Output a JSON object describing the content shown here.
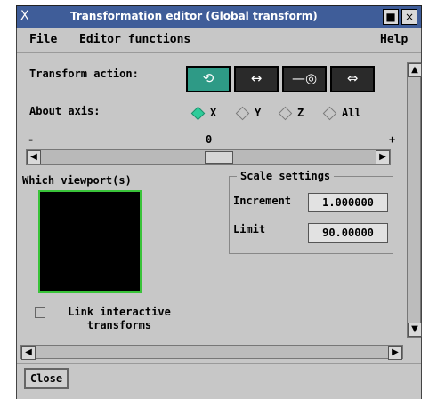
{
  "window": {
    "title": "Transformation editor (Global transform)",
    "app_icon": "X",
    "min_label": "■",
    "close_label": "×"
  },
  "menu": {
    "file": "File",
    "editor": "Editor functions",
    "help": "Help"
  },
  "transform": {
    "label": "Transform action:",
    "buttons": [
      {
        "name": "rotate",
        "glyph": "⟲⟳"
      },
      {
        "name": "translate",
        "glyph": "↔"
      },
      {
        "name": "scale",
        "glyph": "—◎"
      },
      {
        "name": "move",
        "glyph": "⇔"
      }
    ],
    "selected": "rotate"
  },
  "axis": {
    "label": "About axis:",
    "options": [
      "X",
      "Y",
      "Z",
      "All"
    ],
    "selected": "X"
  },
  "slider": {
    "min_label": "-",
    "zero_label": "0",
    "max_label": "+",
    "value": 0
  },
  "viewport": {
    "label": "Which viewport(s)"
  },
  "scale_settings": {
    "title": "Scale settings",
    "increment_label": "Increment",
    "increment_value": "1.000000",
    "limit_label": "Limit",
    "limit_value": "90.00000"
  },
  "link": {
    "label": "Link interactive transforms",
    "checked": false
  },
  "close_label": "Close",
  "colors": {
    "title_bar": "#3f5d99",
    "selected_button": "#2e9a86",
    "radio_on": "#2ecc9a",
    "viewport_border": "#39c339"
  }
}
